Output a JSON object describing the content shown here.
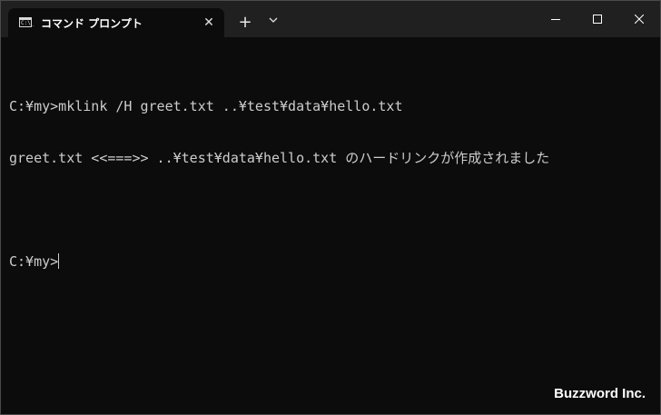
{
  "window": {
    "tab_icon_text": "C:\\_",
    "tab_title": "コマンド プロンプト",
    "tab_close_icon": "close-icon",
    "new_tab_icon": "plus-icon",
    "dropdown_icon": "chevron-down-icon",
    "controls": [
      "minimize-icon",
      "maximize-icon",
      "close-icon"
    ]
  },
  "terminal": {
    "lines": [
      "C:¥my>mklink /H greet.txt ..¥test¥data¥hello.txt",
      "greet.txt <<===>> ..¥test¥data¥hello.txt のハードリンクが作成されました",
      "",
      "C:¥my>"
    ]
  },
  "watermark": "Buzzword Inc.",
  "colors": {
    "background": "#0c0c0c",
    "titlebar": "#202020",
    "text": "#cccccc"
  }
}
